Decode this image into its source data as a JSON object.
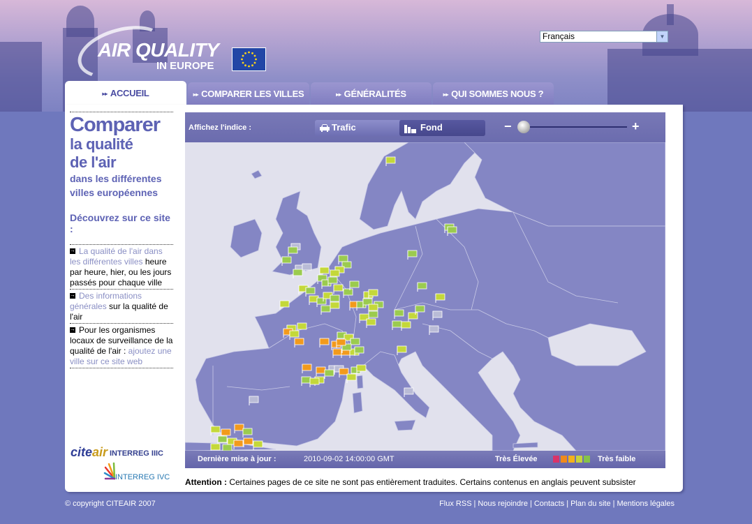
{
  "logo": {
    "line1": "AIR QUALITY",
    "line2": "IN EUROPE"
  },
  "language": {
    "selected": "Français"
  },
  "tabs": [
    {
      "label": "ACCUEIL",
      "active": true
    },
    {
      "label": "COMPARER LES VILLES",
      "active": false
    },
    {
      "label": "GÉNÉRALITÉS",
      "active": false
    },
    {
      "label": "QUI SOMMES NOUS ?",
      "active": false
    }
  ],
  "sidebar": {
    "title1": "Comparer",
    "title2": "la qualité",
    "title3": "de l'air",
    "subtitle1": "dans les différentes",
    "subtitle2": "villes européennes",
    "discover": "Découvrez sur ce site :",
    "items": [
      {
        "link": "La qualité de l'air dans les différentes villes",
        "rest": " heure par heure, hier, ou les jours passés pour chaque ville"
      },
      {
        "link": "Des informations générales",
        "rest": " sur la qualité de l'air"
      },
      {
        "pre": "Pour les organismes locaux de surveillance de la qualité de l'air : ",
        "link": "ajoutez une ville sur ce site web"
      }
    ]
  },
  "partners": {
    "citeair_a": "cite",
    "citeair_b": "air",
    "interreg3": "INTERREG IIIC",
    "interreg4": "INTERREG IVC"
  },
  "map": {
    "index_label": "Affichez l'indice :",
    "btn_trafic": "Trafic",
    "btn_fond": "Fond",
    "zoom_minus": "−",
    "zoom_plus": "+",
    "update_label": "Dernière mise à jour :",
    "update_value": "2010-09-02 14:00:00 GMT",
    "legend_high": "Très Élevée",
    "legend_low": "Très faible",
    "legend_colors": [
      "#d9346a",
      "#f08a1c",
      "#f4b21a",
      "#c8d23b",
      "#86c24a"
    ],
    "colors": {
      "sea": "#e1e1ed",
      "land": "#8486c4",
      "border": "#c9cae6",
      "marker_green": "#9bcb4f",
      "marker_lime": "#c4d83a",
      "marker_yellow": "#f2b31b",
      "marker_orange": "#f29a1c",
      "marker_grey": "#b9bbd6"
    }
  },
  "attention": {
    "bold": "Attention :",
    "text": " Certaines pages de ce site ne sont pas entièrement traduites. Certains contenus en anglais peuvent subsister"
  },
  "footer": {
    "copyright": "© copyright CITEAIR 2007",
    "links": [
      "Flux RSS",
      "Nous rejoindre",
      "Contacts",
      "Plan du site",
      "Mentions légales"
    ]
  }
}
